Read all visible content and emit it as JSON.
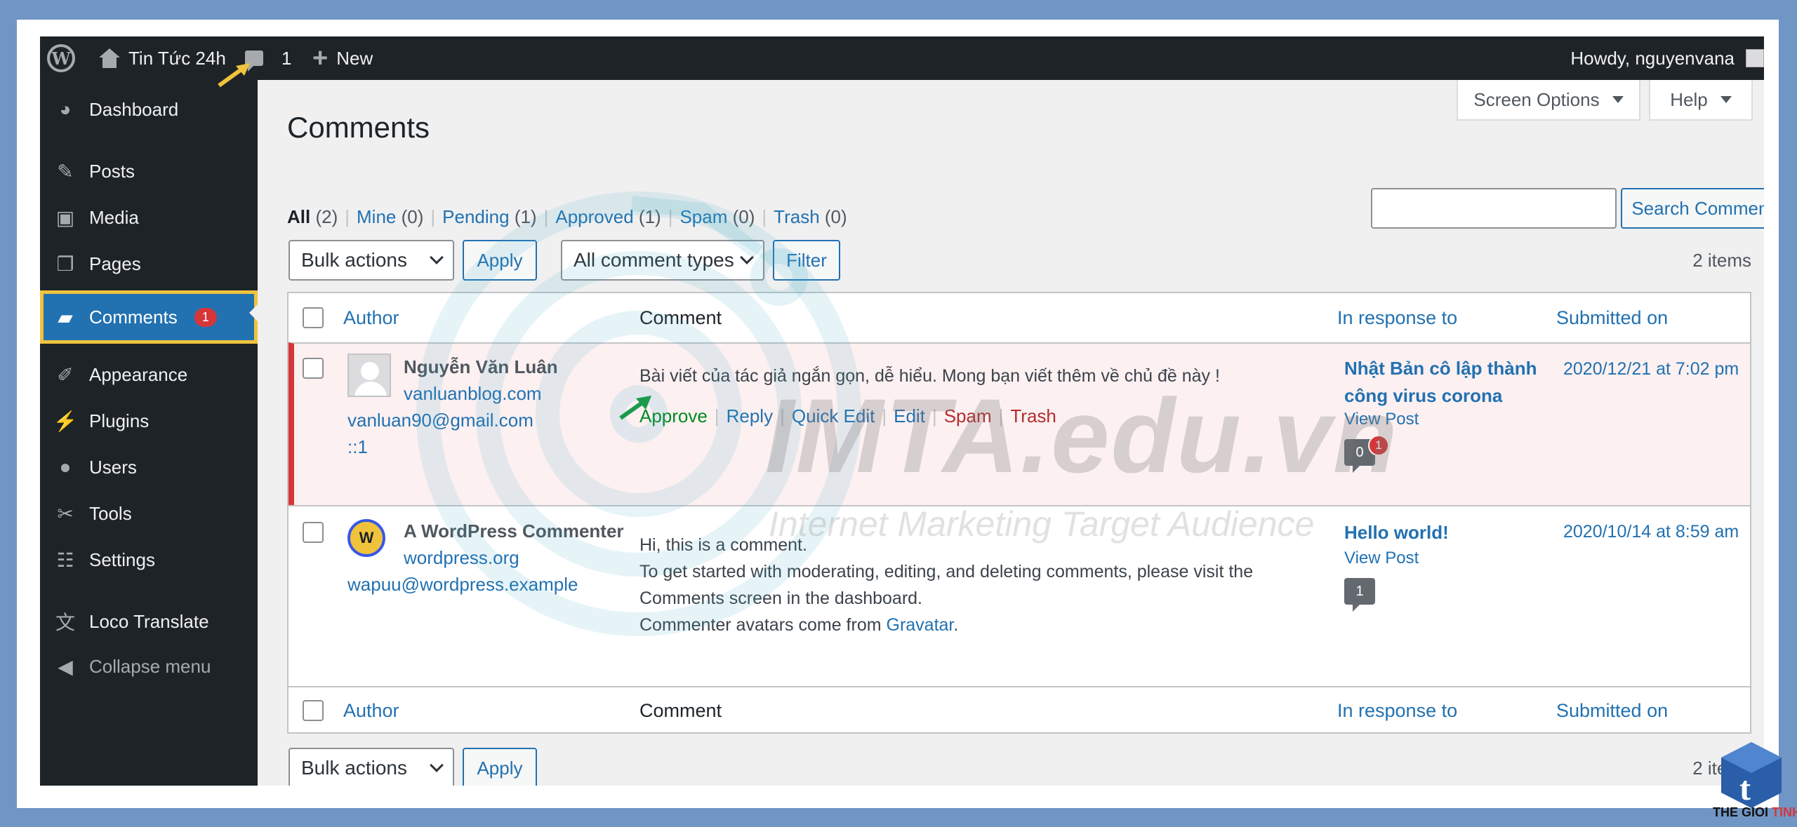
{
  "adminbar": {
    "site_name": "Tin Tức 24h",
    "comment_count": "1",
    "new_label": "New",
    "howdy": "Howdy, nguyenvana"
  },
  "sidebar": {
    "items": [
      {
        "label": "Dashboard",
        "icon": "dashboard-icon"
      },
      {
        "label": "Posts",
        "icon": "pin-icon"
      },
      {
        "label": "Media",
        "icon": "media-icon"
      },
      {
        "label": "Pages",
        "icon": "pages-icon"
      },
      {
        "label": "Comments",
        "icon": "comment-icon",
        "badge": "1"
      },
      {
        "label": "Appearance",
        "icon": "brush-icon"
      },
      {
        "label": "Plugins",
        "icon": "plugin-icon"
      },
      {
        "label": "Users",
        "icon": "user-icon"
      },
      {
        "label": "Tools",
        "icon": "wrench-icon"
      },
      {
        "label": "Settings",
        "icon": "settings-icon"
      },
      {
        "label": "Loco Translate",
        "icon": "translate-icon"
      },
      {
        "label": "Collapse menu",
        "icon": "collapse-icon"
      }
    ]
  },
  "screen_options": "Screen Options",
  "help": "Help",
  "page_title": "Comments",
  "filters": [
    {
      "label": "All",
      "count": "(2)"
    },
    {
      "label": "Mine",
      "count": "(0)"
    },
    {
      "label": "Pending",
      "count": "(1)"
    },
    {
      "label": "Approved",
      "count": "(1)"
    },
    {
      "label": "Spam",
      "count": "(0)"
    },
    {
      "label": "Trash",
      "count": "(0)"
    }
  ],
  "search": {
    "placeholder": "",
    "button": "Search Comments"
  },
  "bulk_actions": "Bulk actions",
  "apply": "Apply",
  "comment_types": "All comment types",
  "filter_button": "Filter",
  "items_count": "2 items",
  "columns": {
    "author": "Author",
    "comment": "Comment",
    "in_response_to": "In response to",
    "submitted_on": "Submitted on"
  },
  "comments": [
    {
      "author_name": "Nguyễn Văn Luân",
      "author_url": "vanluanblog.com",
      "author_email": "vanluan90@gmail.com",
      "author_ip": "::1",
      "text": "Bài viết của tác giả ngắn gọn, dễ hiểu. Mong bạn viết thêm về chủ đề này !",
      "actions": [
        "Approve",
        "Reply",
        "Quick Edit",
        "Edit",
        "Spam",
        "Trash"
      ],
      "post_title_line1": "Nhật Bản cô lập thành",
      "post_title_line2": "công virus corona",
      "view_post": "View Post",
      "approved_count": "0",
      "pending_count": "1",
      "date": "2020/12/21 at 7:02 pm"
    },
    {
      "author_name": "A WordPress Commenter",
      "author_url": "wordpress.org",
      "author_email": "wapuu@wordpress.example",
      "text_line1": "Hi, this is a comment.",
      "text_line2": "To get started with moderating, editing, and deleting comments, please visit the",
      "text_line3": "Comments screen in the dashboard.",
      "text_line4_prefix": "Commenter avatars come from ",
      "text_line4_link": "Gravatar",
      "text_line4_suffix": ".",
      "post_title": "Hello world!",
      "view_post": "View Post",
      "approved_count": "1",
      "date": "2020/10/14 at 8:59 am"
    }
  ],
  "watermark": {
    "title": "IMTA.edu.vn",
    "subtitle": "Internet Marketing Target Audience"
  },
  "corner_logo": {
    "letter": "t",
    "brand": "THE GIOI",
    "brand2": "TINHOC"
  },
  "colors": {
    "admin_dark": "#1d2327",
    "wp_blue": "#2271b1",
    "highlight_yellow": "#f0c33c",
    "pending_red": "#d63638",
    "frame_blue": "#7096c5",
    "arrow_green": "#1a9b4b"
  }
}
